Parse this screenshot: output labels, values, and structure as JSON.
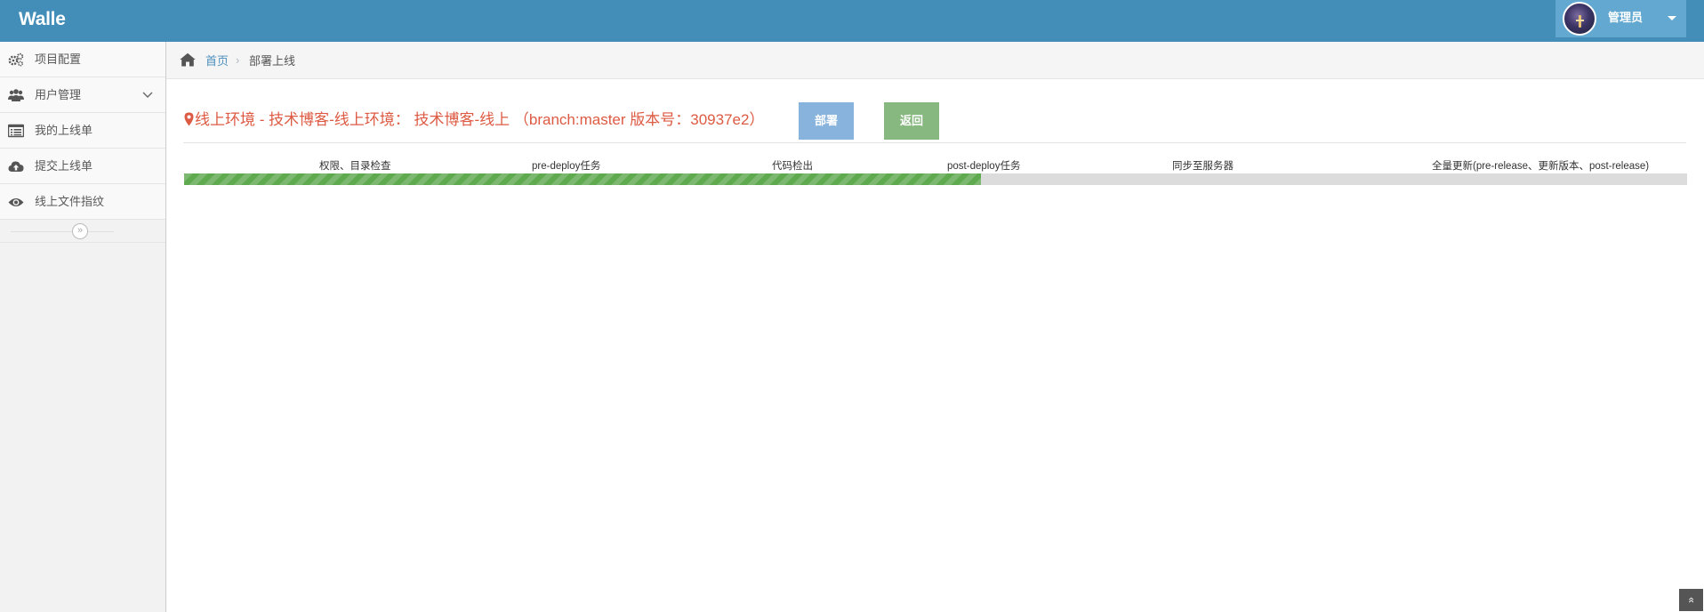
{
  "app": {
    "brand": "Walle"
  },
  "user": {
    "name": "管理员"
  },
  "sidebar": {
    "items": [
      {
        "label": "项目配置",
        "icon": "cogs-icon"
      },
      {
        "label": "用户管理",
        "icon": "users-icon",
        "has_submenu": true
      },
      {
        "label": "我的上线单",
        "icon": "list-icon"
      },
      {
        "label": "提交上线单",
        "icon": "cloud-upload-icon"
      },
      {
        "label": "线上文件指纹",
        "icon": "eye-icon"
      }
    ],
    "collapse_glyph": "»"
  },
  "breadcrumb": {
    "home": "首页",
    "separator": "›",
    "current": "部署上线"
  },
  "main": {
    "title": "线上环境 - 技术博客-线上环境： 技术博客-线上 （branch:master 版本号：30937e2）",
    "deploy_label": "部署",
    "back_label": "返回",
    "steps": [
      "权限、目录检查",
      "pre-deploy任务",
      "代码检出",
      "post-deploy任务",
      "同步至服务器",
      "全量更新(pre-release、更新版本、post-release)"
    ],
    "progress_percent": 53
  },
  "scroll_top_glyph": "»",
  "colors": {
    "navbar": "#438eb9",
    "title": "#dd5a43",
    "deploy_button": "#87b3dc",
    "back_button": "#87b87f",
    "progress": "#5fa94f"
  }
}
